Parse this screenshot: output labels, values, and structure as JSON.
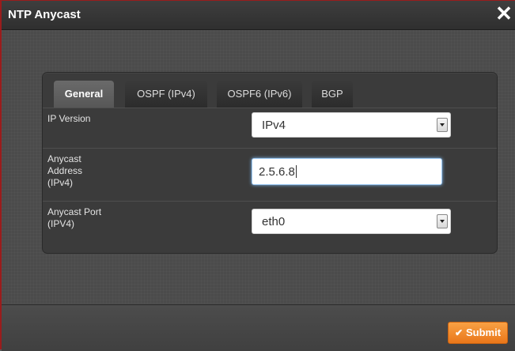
{
  "dialog": {
    "title": "NTP Anycast",
    "close_icon": "close-icon"
  },
  "tabs": [
    {
      "label": "General",
      "active": true
    },
    {
      "label": "OSPF (IPv4)",
      "active": false
    },
    {
      "label": "OSPF6 (IPv6)",
      "active": false
    },
    {
      "label": "BGP",
      "active": false
    }
  ],
  "form": {
    "ip_version": {
      "label": "IP Version",
      "value": "IPv4"
    },
    "anycast_address": {
      "label": "Anycast\nAddress\n(IPv4)",
      "value": "2.5.6.8"
    },
    "anycast_port": {
      "label": "Anycast Port\n(IPV4)",
      "value": "eth0"
    }
  },
  "footer": {
    "submit_label": "Submit",
    "submit_icon": "check-icon"
  },
  "colors": {
    "accent_orange": "#f08a2c",
    "title_border": "#9a1c1c",
    "panel_bg": "#3b3b3b"
  }
}
